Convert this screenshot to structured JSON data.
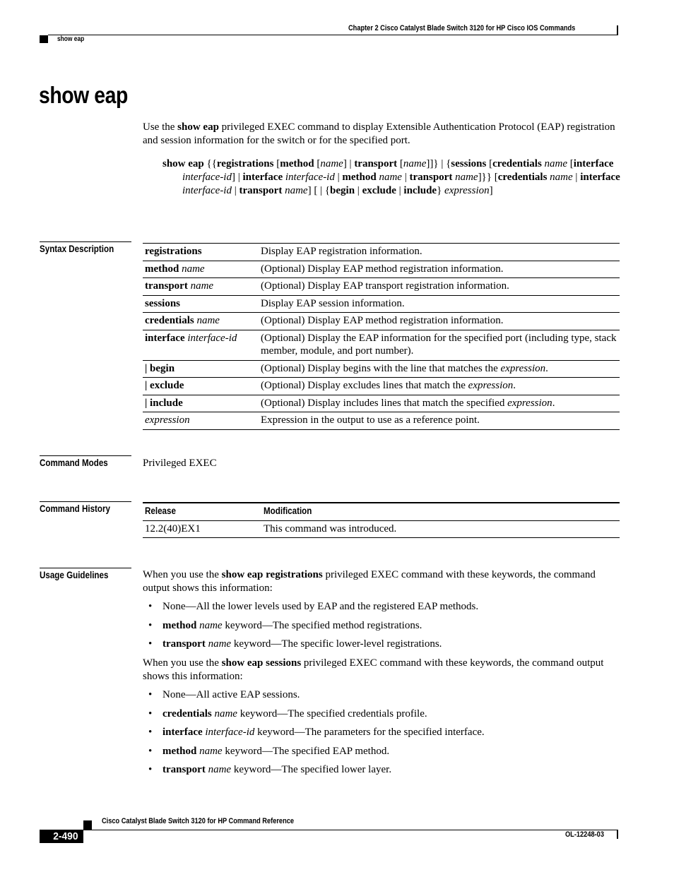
{
  "header": {
    "chapter": "Chapter 2 Cisco Catalyst Blade Switch 3120 for HP Cisco IOS Commands",
    "section": "show eap"
  },
  "title": "show eap",
  "intro": {
    "t1": "Use the ",
    "cmd": "show eap",
    "t2": " privileged EXEC command to display Extensible Authentication Protocol (EAP) registration and session information for the switch or for the specified port."
  },
  "syntax_tokens": [
    {
      "s": "b",
      "t": "show eap"
    },
    {
      "s": "n",
      "t": " {{"
    },
    {
      "s": "b",
      "t": "registrations"
    },
    {
      "s": "n",
      "t": " ["
    },
    {
      "s": "b",
      "t": "method"
    },
    {
      "s": "n",
      "t": " ["
    },
    {
      "s": "i",
      "t": "name"
    },
    {
      "s": "n",
      "t": "] | "
    },
    {
      "s": "b",
      "t": "transport"
    },
    {
      "s": "n",
      "t": " ["
    },
    {
      "s": "i",
      "t": "name"
    },
    {
      "s": "n",
      "t": "]]} | {"
    },
    {
      "s": "b",
      "t": "sessions"
    },
    {
      "s": "n",
      "t": " ["
    },
    {
      "s": "b",
      "t": "credentials"
    },
    {
      "s": "n",
      "t": " "
    },
    {
      "s": "i",
      "t": "name"
    },
    {
      "s": "n",
      "t": " ["
    },
    {
      "s": "b",
      "t": "interface"
    },
    {
      "s": "n",
      "t": " "
    },
    {
      "s": "i",
      "t": "interface-id"
    },
    {
      "s": "n",
      "t": "] | "
    },
    {
      "s": "b",
      "t": "interface"
    },
    {
      "s": "n",
      "t": " "
    },
    {
      "s": "i",
      "t": "interface-id"
    },
    {
      "s": "n",
      "t": " | "
    },
    {
      "s": "b",
      "t": "method"
    },
    {
      "s": "n",
      "t": " "
    },
    {
      "s": "i",
      "t": "name"
    },
    {
      "s": "n",
      "t": " | "
    },
    {
      "s": "b",
      "t": "transport"
    },
    {
      "s": "n",
      "t": " "
    },
    {
      "s": "i",
      "t": "name"
    },
    {
      "s": "n",
      "t": "]}} ["
    },
    {
      "s": "b",
      "t": "credentials"
    },
    {
      "s": "n",
      "t": " "
    },
    {
      "s": "i",
      "t": "name"
    },
    {
      "s": "n",
      "t": " | "
    },
    {
      "s": "b",
      "t": "interface"
    },
    {
      "s": "n",
      "t": " "
    },
    {
      "s": "i",
      "t": "interface-id"
    },
    {
      "s": "n",
      "t": " | "
    },
    {
      "s": "b",
      "t": "transport"
    },
    {
      "s": "n",
      "t": " "
    },
    {
      "s": "i",
      "t": "name"
    },
    {
      "s": "n",
      "t": "] [ | {"
    },
    {
      "s": "b",
      "t": "begin"
    },
    {
      "s": "n",
      "t": " | "
    },
    {
      "s": "b",
      "t": "exclude"
    },
    {
      "s": "n",
      "t": " | "
    },
    {
      "s": "b",
      "t": "include"
    },
    {
      "s": "n",
      "t": "} "
    },
    {
      "s": "i",
      "t": "expression"
    },
    {
      "s": "n",
      "t": "]"
    }
  ],
  "syntax_description": {
    "label": "Syntax Description",
    "rows": [
      {
        "kw": "registrations",
        "arg": "",
        "desc": "Display EAP registration information.",
        "desc_it": "",
        "desc_end": ""
      },
      {
        "kw": "method",
        "arg": "name",
        "desc": "(Optional) Display EAP method registration information.",
        "desc_it": "",
        "desc_end": ""
      },
      {
        "kw": "transport",
        "arg": "name",
        "desc": "(Optional) Display EAP transport registration information.",
        "desc_it": "",
        "desc_end": ""
      },
      {
        "kw": "sessions",
        "arg": "",
        "desc": "Display EAP session information.",
        "desc_it": "",
        "desc_end": ""
      },
      {
        "kw": "credentials",
        "arg": "name",
        "desc": "(Optional) Display EAP method registration information.",
        "desc_it": "",
        "desc_end": ""
      },
      {
        "kw": "interface",
        "arg": "interface-id",
        "desc": "(Optional) Display the EAP information for the specified port (including type, stack member, module, and port number).",
        "desc_it": "",
        "desc_end": ""
      },
      {
        "kw": "| begin",
        "arg": "",
        "desc": "(Optional) Display begins with the line that matches the ",
        "desc_it": "expression",
        "desc_end": "."
      },
      {
        "kw": "| exclude",
        "arg": "",
        "desc": "(Optional) Display excludes lines that match the ",
        "desc_it": "expression",
        "desc_end": "."
      },
      {
        "kw": "| include",
        "arg": "",
        "desc": "(Optional) Display includes lines that match the specified ",
        "desc_it": "expression",
        "desc_end": "."
      },
      {
        "kw": "",
        "arg": "expression",
        "desc": "Expression in the output to use as a reference point.",
        "desc_it": "",
        "desc_end": ""
      }
    ]
  },
  "command_modes": {
    "label": "Command Modes",
    "value": "Privileged EXEC"
  },
  "command_history": {
    "label": "Command History",
    "headers": [
      "Release",
      "Modification"
    ],
    "rows": [
      {
        "release": "12.2(40)EX1",
        "modification": "This command was introduced."
      }
    ]
  },
  "usage_guidelines": {
    "label": "Usage Guidelines",
    "p1": {
      "t1": "When you use the ",
      "cmd": "show eap registrations",
      "t2": " privileged EXEC command with these keywords, the command output shows this information:"
    },
    "bullets1": [
      {
        "kw": "",
        "arg": "",
        "text": "None—All the lower levels used by EAP and the registered EAP methods."
      },
      {
        "kw": "method",
        "arg": "name",
        "text": " keyword—The specified method registrations."
      },
      {
        "kw": "transport",
        "arg": "name",
        "text": " keyword—The specific lower-level registrations."
      }
    ],
    "p2": {
      "t1": "When you use the ",
      "cmd": "show eap sessions",
      "t2": " privileged EXEC command with these keywords, the command output shows this information:"
    },
    "bullets2": [
      {
        "kw": "",
        "arg": "",
        "text": "None—All active EAP sessions."
      },
      {
        "kw": "credentials",
        "arg": "name",
        "text": " keyword—The specified credentials profile."
      },
      {
        "kw": "interface",
        "arg": "interface-id",
        "text": " keyword—The parameters for the specified interface."
      },
      {
        "kw": "method",
        "arg": "name",
        "text": " keyword—The specified EAP method."
      },
      {
        "kw": "transport",
        "arg": "name",
        "text": " keyword—The specified lower layer."
      }
    ]
  },
  "footer": {
    "title": "Cisco Catalyst Blade Switch 3120 for HP Command Reference",
    "page": "2-490",
    "doc_id": "OL-12248-03"
  }
}
